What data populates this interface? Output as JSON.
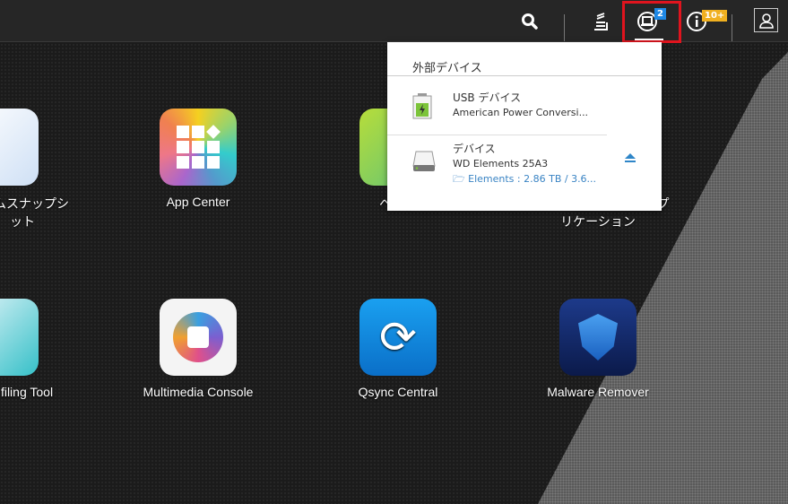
{
  "topbar": {
    "search_icon": "search-icon",
    "tasks_icon": "tasks-icon",
    "external_devices_badge": "2",
    "notifications_badge": "10+",
    "user_icon": "user-icon"
  },
  "colors": {
    "highlight": "#e0141e",
    "device_badge": "#1e88e5",
    "notification_badge": "#f0b020",
    "link": "#3a84c4"
  },
  "apps": [
    {
      "label_line1": "ムスナップシ",
      "label_line2": "ット"
    },
    {
      "label_line1": "App Center"
    },
    {
      "label_line1": "ヘルプ"
    },
    {
      "label_line1": "プ",
      "label_line2": "リケーション"
    },
    {
      "label_line1": "filing Tool"
    },
    {
      "label_line1": "Multimedia Console"
    },
    {
      "label_line1": "Qsync Central"
    },
    {
      "label_line1": "Malware Remover"
    }
  ],
  "dropdown": {
    "title": "外部デバイス",
    "devices": [
      {
        "type": "USB デバイス",
        "name": "American Power Conversi...",
        "icon": "battery-icon"
      },
      {
        "type": "デバイス",
        "name": "WD Elements 25A3",
        "volume": "Elements : 2.86 TB / 3.6...",
        "icon": "hard-drive-icon",
        "action": "eject"
      }
    ]
  }
}
